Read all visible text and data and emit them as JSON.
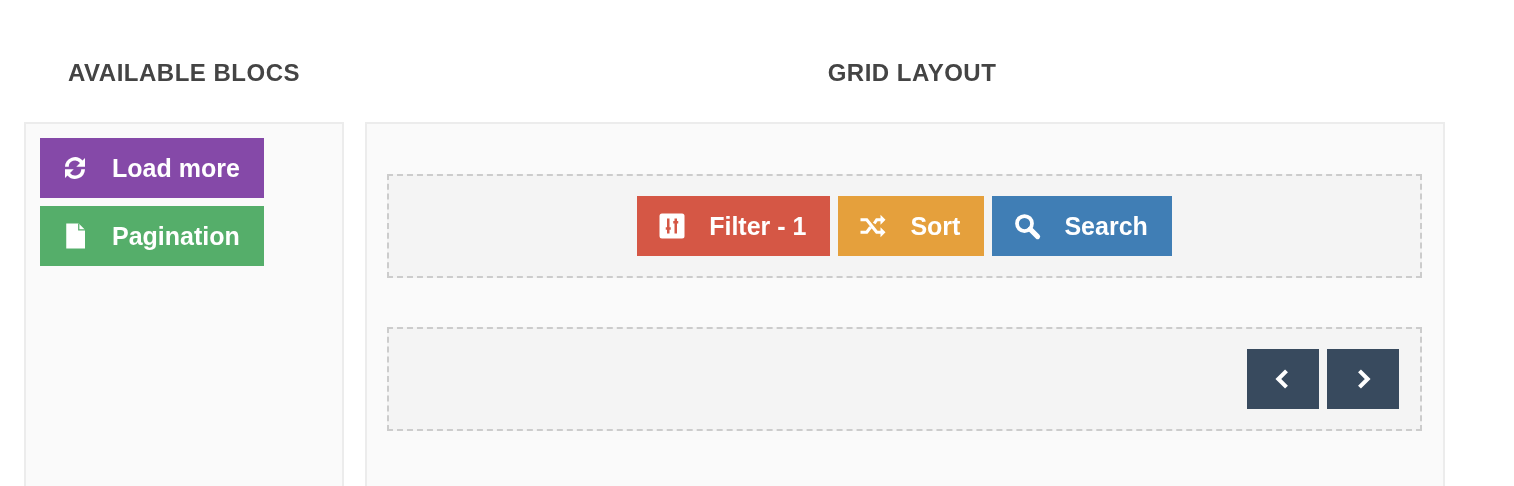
{
  "available_blocs": {
    "title": "AVAILABLE BLOCS",
    "blocks": [
      {
        "label": "Load more",
        "kind": "refresh",
        "color": "#8549a8"
      },
      {
        "label": "Pagination",
        "kind": "page",
        "color": "#55ae6a"
      }
    ]
  },
  "grid_layout": {
    "title": "GRID LAYOUT",
    "rows": [
      {
        "kind": "controls",
        "blocks": [
          {
            "label": "Filter - 1",
            "kind": "filter",
            "color": "#d55745"
          },
          {
            "label": "Sort",
            "kind": "shuffle",
            "color": "#e5a03c"
          },
          {
            "label": "Search",
            "kind": "search",
            "color": "#407eb5"
          }
        ]
      },
      {
        "kind": "navigation",
        "blocks": [
          {
            "kind": "prev",
            "color": "#384a5e"
          },
          {
            "kind": "next",
            "color": "#384a5e"
          }
        ]
      }
    ]
  }
}
